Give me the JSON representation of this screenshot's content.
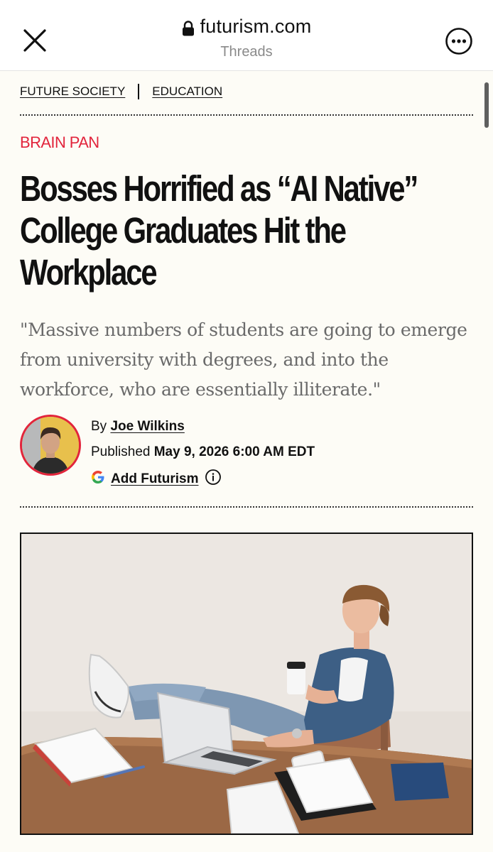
{
  "browser": {
    "domain": "futurism.com",
    "subtitle": "Threads"
  },
  "article": {
    "categories": [
      "FUTURE SOCIETY",
      "EDUCATION"
    ],
    "kicker": "BRAIN PAN",
    "headline": "Bosses Horrified as “AI Native” College Graduates Hit the Workplace",
    "dek": "\"Massive numbers of students are going to emerge from university with degrees, and into the workforce, who are essentially illiterate.\"",
    "by_prefix": "By",
    "author": "Joe Wilkins",
    "published_prefix": "Published",
    "published_date": "May 9, 2026 6:00 AM EDT",
    "add_label": "Add Futurism"
  },
  "colors": {
    "accent": "#e2243c",
    "background": "#fdfcf6"
  }
}
